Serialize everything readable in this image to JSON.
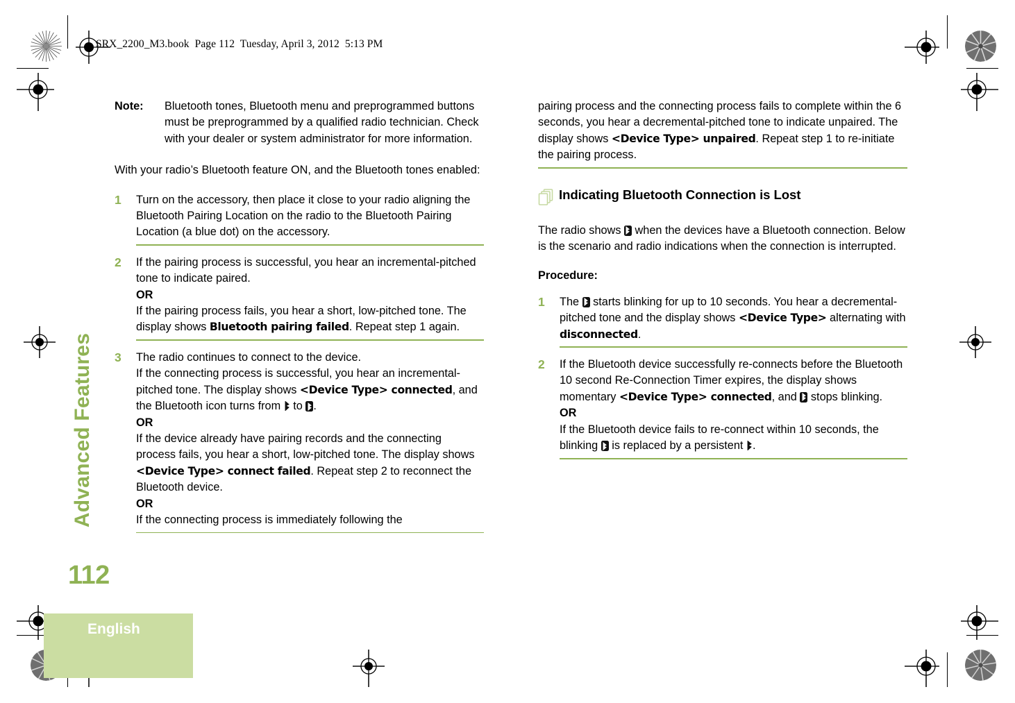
{
  "file_info": "SRX_2200_M3.book  Page 112  Tuesday, April 3, 2012  5:13 PM",
  "chapter_tab": {
    "label": "Advanced Features",
    "folio": "112"
  },
  "footer": {
    "language": "English"
  },
  "colors": {
    "accent_green": "#8FB254",
    "tab_block_green": "#CBDDA2",
    "icon_green": "#C6D9A2",
    "text": "#000000"
  },
  "left_column": {
    "note": {
      "label": "Note:",
      "body": "Bluetooth tones, Bluetooth menu and preprogrammed buttons must be preprogrammed by a qualified radio technician. Check with your dealer or system administrator for more information."
    },
    "intro": "With your radio’s Bluetooth feature ON, and the Bluetooth tones enabled:",
    "steps": [
      {
        "number": "1",
        "text": "Turn on the accessory, then place it close to your radio aligning the Bluetooth Pairing Location on the radio to the Bluetooth Pairing Location (a blue dot) on the accessory."
      },
      {
        "number": "2",
        "part1": "If the pairing process is successful, you hear an incremental-pitched tone to indicate paired.",
        "or": "OR",
        "part2a": "If the pairing process fails, you hear a short, low-pitched tone. The display shows ",
        "lcd1": "Bluetooth pairing failed",
        "part2b": ". Repeat step 1 again."
      },
      {
        "number": "3",
        "part1": "The radio continues to connect to the device.",
        "part2a": "If the connecting process is successful, you hear an incremental-pitched tone. The display shows ",
        "lcd1": "<Device Type> connected",
        "part2b": ", and the Bluetooth icon turns from ",
        "icon_from": "bluetooth-plain-icon",
        "part2c": " to ",
        "icon_to": "bluetooth-connected-icon",
        "part2d": ".",
        "or1": "OR",
        "part3a": "If the device already have pairing records and the connecting process fails, you hear a short, low-pitched tone. The display shows ",
        "lcd2": "<Device Type> connect failed",
        "part3b": ". Repeat step 2 to reconnect the Bluetooth device.",
        "or2": "OR",
        "part4": "If the connecting process is immediately following the"
      }
    ]
  },
  "right_column": {
    "continued": {
      "part_a": "pairing process and the connecting process fails to complete within the 6 seconds, you hear a decremental-pitched tone to indicate unpaired. The display shows ",
      "lcd": "<Device Type> unpaired",
      "part_b": ". Repeat step 1 to re-initiate the pairing process."
    },
    "section": {
      "icon": "stacked-pages-icon",
      "title": "Indicating Bluetooth Connection is Lost",
      "intro_a": "The radio shows ",
      "intro_icon": "bluetooth-connected-icon",
      "intro_b": " when the devices have a Bluetooth connection. Below is the scenario and radio indications when the connection is interrupted."
    },
    "procedure_label": "Procedure:",
    "steps": [
      {
        "number": "1",
        "part_a": "The ",
        "icon": "bluetooth-connected-icon",
        "part_b": " starts blinking for up to 10 seconds. You hear a decremental-pitched tone and the display shows ",
        "lcd1": "<Device Type>",
        "part_c": " alternating with ",
        "lcd2": "disconnected",
        "part_d": "."
      },
      {
        "number": "2",
        "part_a": "If the Bluetooth device successfully re-connects before the Bluetooth 10 second Re-Connection Timer expires, the display shows momentary ",
        "lcd1": "<Device Type> connected",
        "part_b": ", and ",
        "icon1": "bluetooth-connected-icon",
        "part_c": " stops blinking.",
        "or": "OR",
        "part_d": "If the Bluetooth device fails to re-connect within 10 seconds, the blinking ",
        "icon2": "bluetooth-connected-icon",
        "part_e": " is replaced by a persistent ",
        "icon3": "bluetooth-plain-icon",
        "part_f": "."
      }
    ]
  }
}
